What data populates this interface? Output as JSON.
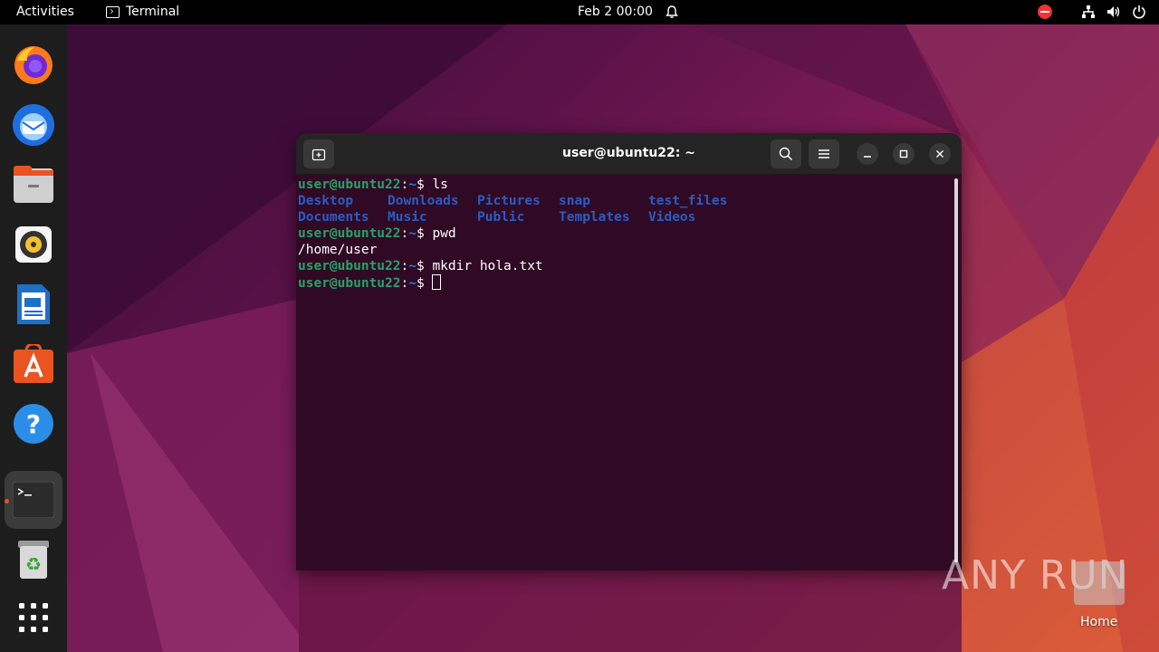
{
  "topbar": {
    "activities": "Activities",
    "app_name": "Terminal",
    "clock": "Feb 2  00:00"
  },
  "dock": {
    "items": [
      {
        "name": "firefox"
      },
      {
        "name": "thunderbird"
      },
      {
        "name": "files"
      },
      {
        "name": "rhythmbox"
      },
      {
        "name": "libreoffice-writer"
      },
      {
        "name": "software-center"
      },
      {
        "name": "help"
      },
      {
        "name": "terminal",
        "active": true
      },
      {
        "name": "trash"
      },
      {
        "name": "show-applications"
      }
    ]
  },
  "terminal": {
    "title": "user@ubuntu22: ~",
    "prompt_user": "user@ubuntu22",
    "prompt_sep": ":",
    "prompt_path": "~",
    "prompt_dollar": "$ ",
    "lines": [
      {
        "type": "cmd",
        "cmd": "ls"
      },
      {
        "type": "dirs",
        "items": [
          "Desktop",
          "Downloads",
          "Pictures",
          "snap",
          "test_files"
        ]
      },
      {
        "type": "dirs",
        "items": [
          "Documents",
          "Music",
          "Public",
          "Templates",
          "Videos"
        ]
      },
      {
        "type": "cmd",
        "cmd": "pwd"
      },
      {
        "type": "out",
        "text": "/home/user"
      },
      {
        "type": "cmd",
        "cmd": "mkdir hola.txt"
      },
      {
        "type": "cmd",
        "cmd": "",
        "cursor": true
      }
    ]
  },
  "desktop": {
    "home_label": "Home",
    "watermark": "ANY RUN"
  },
  "colors": {
    "accent": "#e95420",
    "terminal_bg": "#300a24",
    "prompt_user": "#26a269",
    "prompt_path": "#2a7bde",
    "dir_color": "#2a5bc4"
  }
}
